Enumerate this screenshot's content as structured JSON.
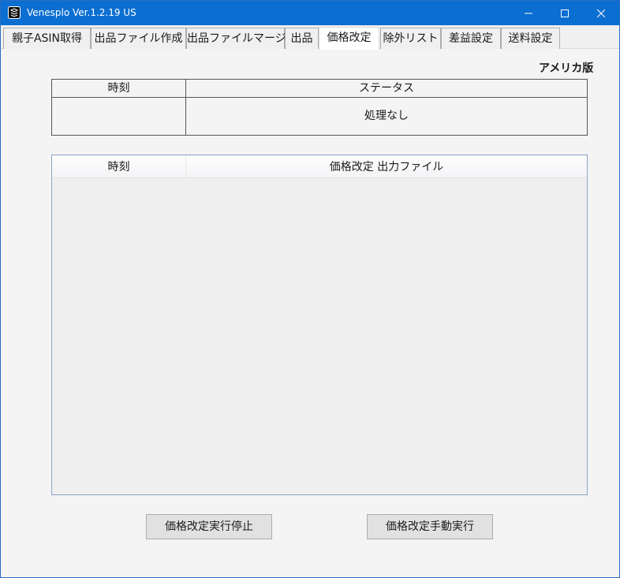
{
  "window": {
    "title": "Venesplo Ver.1.2.19 US"
  },
  "tabs": [
    {
      "label": "親子ASIN取得",
      "active": false
    },
    {
      "label": "出品ファイル作成",
      "active": false
    },
    {
      "label": "出品ファイルマージ",
      "active": false
    },
    {
      "label": "出品",
      "active": false
    },
    {
      "label": "価格改定",
      "active": true
    },
    {
      "label": "除外リスト",
      "active": false
    },
    {
      "label": "差益設定",
      "active": false
    },
    {
      "label": "送料設定",
      "active": false
    }
  ],
  "edition_label": "アメリカ版",
  "status_table": {
    "col_time": "時刻",
    "col_status": "ステータス",
    "row": {
      "time": "",
      "status": "処理なし"
    }
  },
  "output_list": {
    "col_time": "時刻",
    "col_file": "価格改定 出力ファイル",
    "rows": []
  },
  "buttons": {
    "stop": "価格改定実行停止",
    "manual_run": "価格改定手動実行"
  },
  "colors": {
    "titlebar": "#0b6ed1",
    "background": "#f0f0f0",
    "button": "#e1e1e1"
  },
  "icons": {
    "app": "app-icon",
    "minimize": "minimize-icon",
    "maximize": "maximize-icon",
    "close": "close-icon"
  }
}
